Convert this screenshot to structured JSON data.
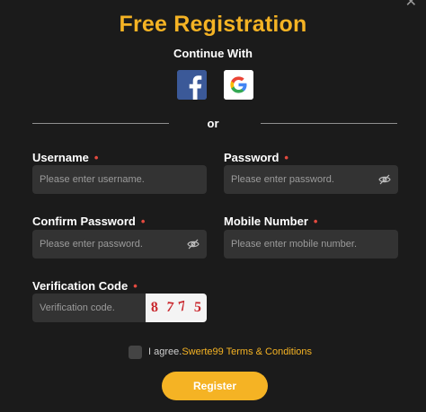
{
  "header": {
    "title": "Free Registration",
    "continue_with": "Continue With",
    "or": "or",
    "close_icon": "close-icon"
  },
  "social": {
    "facebook_icon": "facebook-icon",
    "google_icon": "google-icon"
  },
  "form": {
    "username": {
      "label": "Username",
      "required": "•",
      "placeholder": "Please enter username.",
      "value": ""
    },
    "password": {
      "label": "Password",
      "required": "•",
      "placeholder": "Please enter password.",
      "value": "",
      "icon": "eye-off-icon"
    },
    "confirm_password": {
      "label": "Confirm Password",
      "required": "•",
      "placeholder": "Please enter password.",
      "value": "",
      "icon": "eye-off-icon"
    },
    "mobile": {
      "label": "Mobile Number",
      "required": "•",
      "placeholder": "Please enter mobile number.",
      "value": ""
    },
    "verification": {
      "label": "Verification Code",
      "required": "•",
      "placeholder": "Verification code.",
      "value": ""
    },
    "captcha": [
      "8",
      "7",
      "7",
      "5"
    ]
  },
  "terms": {
    "prefix": "I agree.",
    "link": "Swerte99 Terms & Conditions",
    "checked": false
  },
  "register_label": "Register",
  "colors": {
    "accent": "#f5b324",
    "background": "#1b1b1b",
    "field": "#333333",
    "required": "#e44a3f",
    "facebook": "#3b5998"
  }
}
